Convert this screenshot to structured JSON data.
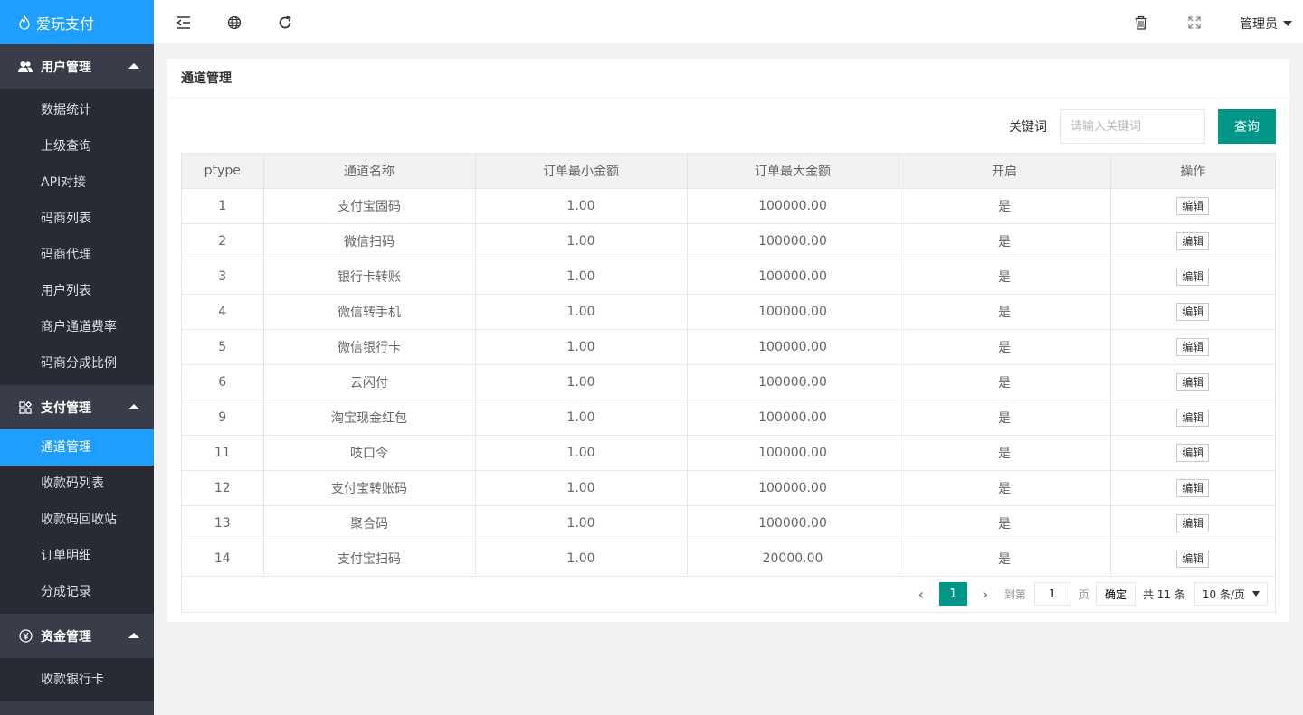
{
  "app": {
    "title": "爱玩支付"
  },
  "sidebar": {
    "groups": [
      {
        "label": "用户管理",
        "items": [
          "数据统计",
          "上级查询",
          "API对接",
          "码商列表",
          "码商代理",
          "用户列表",
          "商户通道费率",
          "码商分成比例"
        ]
      },
      {
        "label": "支付管理",
        "items": [
          "通道管理",
          "收款码列表",
          "收款码回收站",
          "订单明细",
          "分成记录"
        ]
      },
      {
        "label": "资金管理",
        "items": [
          "收款银行卡"
        ]
      }
    ],
    "active": "通道管理"
  },
  "header": {
    "admin_label": "管理员"
  },
  "page": {
    "title": "通道管理"
  },
  "search": {
    "label": "关键词",
    "placeholder": "请输入关键词",
    "button": "查询"
  },
  "table": {
    "headers": [
      "ptype",
      "通道名称",
      "订单最小金额",
      "订单最大金额",
      "开启",
      "操作"
    ],
    "rows": [
      [
        "1",
        "支付宝固码",
        "1.00",
        "100000.00",
        "是",
        "编辑"
      ],
      [
        "2",
        "微信扫码",
        "1.00",
        "100000.00",
        "是",
        "编辑"
      ],
      [
        "3",
        "银行卡转账",
        "1.00",
        "100000.00",
        "是",
        "编辑"
      ],
      [
        "4",
        "微信转手机",
        "1.00",
        "100000.00",
        "是",
        "编辑"
      ],
      [
        "5",
        "微信银行卡",
        "1.00",
        "100000.00",
        "是",
        "编辑"
      ],
      [
        "6",
        "云闪付",
        "1.00",
        "100000.00",
        "是",
        "编辑"
      ],
      [
        "9",
        "淘宝现金红包",
        "1.00",
        "100000.00",
        "是",
        "编辑"
      ],
      [
        "11",
        "吱口令",
        "1.00",
        "100000.00",
        "是",
        "编辑"
      ],
      [
        "12",
        "支付宝转账码",
        "1.00",
        "100000.00",
        "是",
        "编辑"
      ],
      [
        "13",
        "聚合码",
        "1.00",
        "100000.00",
        "是",
        "编辑"
      ],
      [
        "14",
        "支付宝扫码",
        "1.00",
        "20000.00",
        "是",
        "编辑"
      ]
    ]
  },
  "pager": {
    "current": "1",
    "goto_label": "到第",
    "goto_value": "1",
    "page_unit": "页",
    "confirm": "确定",
    "total": "共 11 条",
    "page_size": "10 条/页"
  }
}
